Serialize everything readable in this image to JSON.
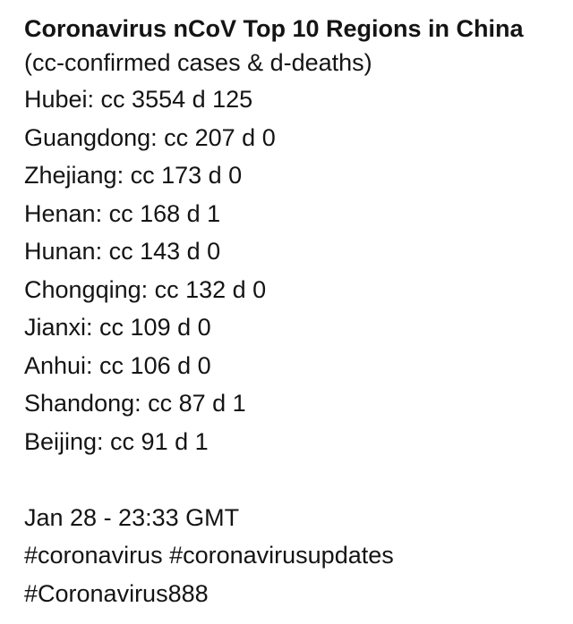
{
  "post": {
    "title": "Coronavirus nCoV Top 10 Regions in China",
    "subtitle": "(cc-confirmed cases & d-deaths)",
    "regions": [
      "Hubei: cc 3554 d 125",
      "Guangdong: cc 207 d 0",
      "Zhejiang: cc 173 d 0",
      "Henan: cc 168 d 1",
      "Hunan: cc 143 d 0",
      "Chongqing: cc 132 d 0",
      "Jianxi: cc 109 d 0",
      "Anhui: cc 106 d 0",
      "Shandong: cc 87 d 1",
      "Beijing: cc 91 d 1"
    ],
    "timestamp": "Jan 28 - 23:33 GMT",
    "hashtags_line1": "#coronavirus #coronavirusupdates",
    "hashtags_line2": "#Coronavirus888"
  }
}
